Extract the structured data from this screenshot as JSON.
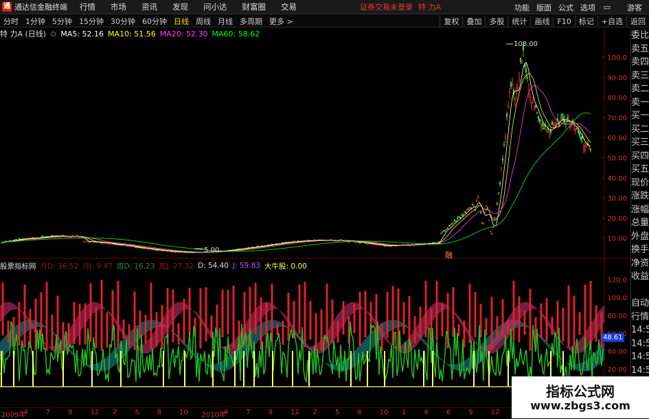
{
  "titlebar": {
    "app_title": "通达信金融终端",
    "menu": [
      "行情",
      "市场",
      "资讯",
      "发现",
      "问小达",
      "财富圈",
      "交易"
    ],
    "notice": "证券交易未登录",
    "stock_name": "特 力A",
    "right_menu": [
      "功能",
      "版面",
      "公式",
      "选项"
    ],
    "guest": "游客",
    "logo_char": "通"
  },
  "toolbar": {
    "periods": [
      "分时",
      "1分钟",
      "5分钟",
      "15分钟",
      "30分钟",
      "60分钟",
      "日线",
      "周线",
      "月线",
      "多周期",
      "更多 >"
    ],
    "active": "日线",
    "right": [
      "复权",
      "叠加",
      "多股",
      "统计",
      "画线",
      "F10",
      "标记",
      "+自选",
      "返回"
    ]
  },
  "ma_bar": {
    "title": "特 力A (日线)",
    "ma5": "MA5: 52.16",
    "ma10": "MA10: 51.56",
    "ma20": "MA20: 52.30",
    "ma60": "MA60: 58.62"
  },
  "indicator_bar": {
    "name": "股票指标网",
    "items": [
      {
        "text": "月D: 36.52",
        "color": "#8b1a1a"
      },
      {
        "text": "月J: 9.47",
        "color": "#8b1a1a"
      },
      {
        "text": "周D: 16.23",
        "color": "#2a8a2a"
      },
      {
        "text": "周J: 27.32",
        "color": "#8b1a1a"
      },
      {
        "text": "D: 54.40",
        "color": "#dddddd"
      },
      {
        "text": "J: 59.83",
        "color": "#c050ff"
      },
      {
        "text": "大牛股: 0.00",
        "color": "#ffff44"
      }
    ]
  },
  "price_axis": [
    "100.0",
    "90.00",
    "80.00",
    "70.00",
    "60.00",
    "50.00",
    "40.00",
    "30.00",
    "20.00",
    "10.00"
  ],
  "ind_axis": [
    "120.0",
    "100.0",
    "80.00",
    "60.00",
    "40.00",
    "20.00"
  ],
  "high_label": "108.00",
  "low_label": "5.00",
  "ind_badge": "48.61",
  "date_labels": [
    "2009年",
    "4",
    "7",
    "9",
    "12",
    "2",
    "5",
    "8",
    "10",
    "2010年",
    "4",
    "7",
    "9",
    "12",
    "2",
    "5",
    "8",
    "10",
    "1",
    "4",
    "6",
    "9",
    "12",
    "2"
  ],
  "sidebar": [
    "委比",
    "卖五",
    "卖四",
    "卖三",
    "卖二",
    "卖一",
    "买一",
    "买二",
    "买三",
    "买四",
    "买五",
    "现价",
    "涨跌",
    "涨幅",
    "总量",
    "外盘",
    "换手",
    "净资",
    "收益",
    "",
    "自动",
    "行情",
    "14:5",
    "14:5",
    "14:5",
    "14:5",
    "14:5",
    "14:5",
    "14:5"
  ],
  "watermark": {
    "title": "指标公式网",
    "url": "www.zbgs3.com"
  },
  "mark_label": "融",
  "colors": {
    "up": "#ff3030",
    "down": "#3cd23c",
    "ma5": "#ffffff",
    "ma10": "#ffff00",
    "ma20": "#ff40ff",
    "ma60": "#00ff00"
  }
}
